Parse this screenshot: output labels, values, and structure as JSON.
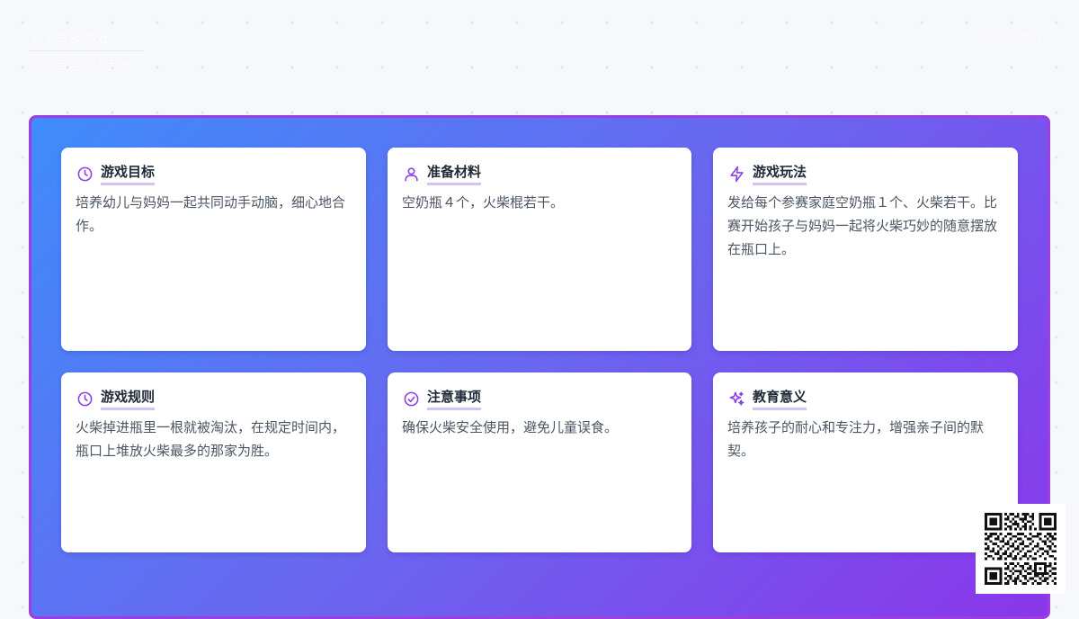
{
  "header": {
    "title": "亲子互动游戏",
    "subtitle": "培养专注与动手能力",
    "date": "2025-05-15"
  },
  "colors": {
    "accent": "#8b3fe6",
    "gradient_start": "#3f8cfb",
    "gradient_end": "#8a36ea",
    "title_underline": "#d4c2f7"
  },
  "cards": [
    {
      "icon": "clock-icon",
      "title": "游戏目标",
      "body": "培养幼儿与妈妈一起共同动手动脑，细心地合作。"
    },
    {
      "icon": "user-icon",
      "title": "准备材料",
      "body": "空奶瓶４个，火柴棍若干。"
    },
    {
      "icon": "lightning-icon",
      "title": "游戏玩法",
      "body": "发给每个参赛家庭空奶瓶１个、火柴若干。比赛开始孩子与妈妈一起将火柴巧妙的随意摆放在瓶口上。"
    },
    {
      "icon": "clock-icon",
      "title": "游戏规则",
      "body": "火柴掉进瓶里一根就被淘汰，在规定时间内，瓶口上堆放火柴最多的那家为胜。"
    },
    {
      "icon": "check-circle-icon",
      "title": "注意事项",
      "body": "确保火柴安全使用，避免儿童误食。"
    },
    {
      "icon": "sparkles-icon",
      "title": "教育意义",
      "body": "培养孩子的耐心和专注力，增强亲子间的默契。"
    }
  ]
}
